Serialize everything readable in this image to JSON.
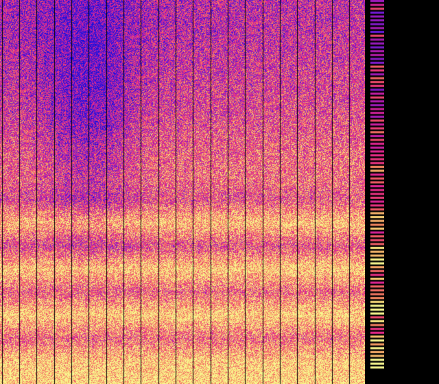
{
  "palette": {
    "background": "#000000",
    "stops": [
      "#1a10d8",
      "#6a1ad8",
      "#b01ab0",
      "#e8288c",
      "#f0506a",
      "#f89060",
      "#f8d878",
      "#f8f890"
    ]
  },
  "gridlines": {
    "color": "#000000",
    "count": 21
  },
  "bands": {
    "description_free": true,
    "levels": [
      {
        "row_fraction": 0.0,
        "mean": 0.3
      },
      {
        "row_fraction": 0.08,
        "mean": 0.32
      },
      {
        "row_fraction": 0.18,
        "mean": 0.38
      },
      {
        "row_fraction": 0.3,
        "mean": 0.45
      },
      {
        "row_fraction": 0.4,
        "mean": 0.55
      },
      {
        "row_fraction": 0.47,
        "mean": 0.58
      },
      {
        "row_fraction": 0.52,
        "mean": 0.5
      },
      {
        "row_fraction": 0.58,
        "mean": 0.85
      },
      {
        "row_fraction": 0.64,
        "mean": 0.5
      },
      {
        "row_fraction": 0.7,
        "mean": 0.9
      },
      {
        "row_fraction": 0.76,
        "mean": 0.58
      },
      {
        "row_fraction": 0.82,
        "mean": 0.92
      },
      {
        "row_fraction": 0.88,
        "mean": 0.6
      },
      {
        "row_fraction": 0.94,
        "mean": 0.9
      },
      {
        "row_fraction": 1.0,
        "mean": 0.95
      }
    ],
    "dark_region": {
      "column_fraction_center": 0.24,
      "strength": 0.28
    }
  }
}
